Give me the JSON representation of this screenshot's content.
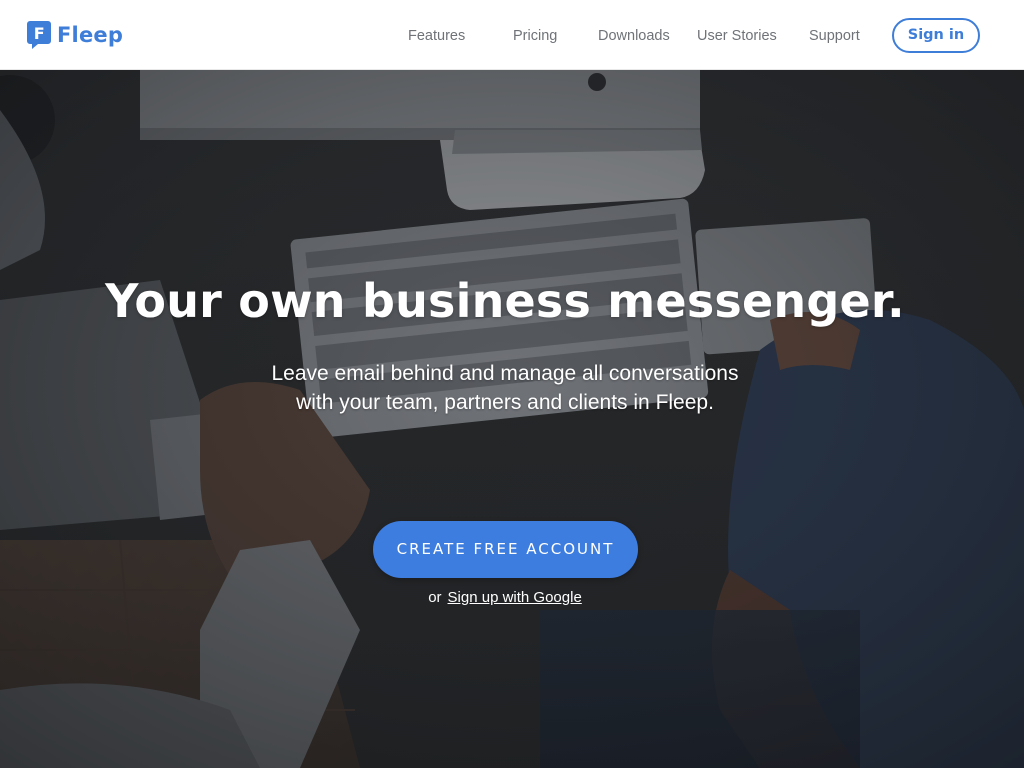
{
  "brand": {
    "name": "Fleep",
    "logo_letter": "F",
    "color": "#3f7ed8"
  },
  "nav": {
    "items": [
      {
        "label": "Features"
      },
      {
        "label": "Pricing"
      },
      {
        "label": "Downloads"
      },
      {
        "label": "User Stories"
      },
      {
        "label": "Support"
      }
    ],
    "signin_label": "Sign in"
  },
  "hero": {
    "headline": "Your own business messenger.",
    "subline_1": "Leave email behind and manage all conversations",
    "subline_2": "with your team, partners and clients in Fleep.",
    "cta_label": "CREATE FREE ACCOUNT",
    "alt_prefix": "or",
    "alt_link": "Sign up with Google",
    "cta_color": "#3e7de0"
  }
}
